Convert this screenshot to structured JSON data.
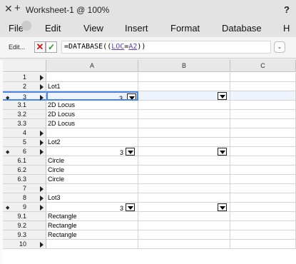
{
  "window": {
    "title": "Worksheet-1 @ 100%",
    "help": "?",
    "close_glyph": "✕",
    "new_glyph": "+"
  },
  "menu": [
    "File",
    "Edit",
    "View",
    "Insert",
    "Format",
    "Database",
    "H"
  ],
  "formula_bar": {
    "edit_label": "Edit...",
    "cancel_glyph": "✕",
    "accept_glyph": "✓",
    "formula_prefix": "=DATABASE((",
    "loc": "LOC",
    "eq": "=",
    "ref": "A2",
    "formula_suffix": "))",
    "dropdown_glyph": "⌄"
  },
  "columns": [
    "A",
    "B",
    "C"
  ],
  "rows": [
    {
      "num": "1",
      "a": "",
      "kind": "normal"
    },
    {
      "num": "2",
      "a": "Lot1",
      "kind": "normal"
    },
    {
      "num": "3",
      "a": "",
      "kind": "db",
      "count": "3",
      "selected": true
    },
    {
      "num": "3.1",
      "a": "2D Locus",
      "kind": "sub"
    },
    {
      "num": "3.2",
      "a": "2D Locus",
      "kind": "sub"
    },
    {
      "num": "3.3",
      "a": "2D Locus",
      "kind": "sub"
    },
    {
      "num": "4",
      "a": "",
      "kind": "normal"
    },
    {
      "num": "5",
      "a": "Lot2",
      "kind": "normal"
    },
    {
      "num": "6",
      "a": "",
      "kind": "db",
      "count": "3"
    },
    {
      "num": "6.1",
      "a": "Circle",
      "kind": "sub"
    },
    {
      "num": "6.2",
      "a": "Circle",
      "kind": "sub"
    },
    {
      "num": "6.3",
      "a": "Circle",
      "kind": "sub"
    },
    {
      "num": "7",
      "a": "",
      "kind": "normal"
    },
    {
      "num": "8",
      "a": "Lot3",
      "kind": "normal"
    },
    {
      "num": "9",
      "a": "",
      "kind": "db",
      "count": "3"
    },
    {
      "num": "9.1",
      "a": "Rectangle",
      "kind": "sub"
    },
    {
      "num": "9.2",
      "a": "Rectangle",
      "kind": "sub"
    },
    {
      "num": "9.3",
      "a": "Rectangle",
      "kind": "sub"
    },
    {
      "num": "10",
      "a": "",
      "kind": "normal"
    }
  ],
  "icons": {
    "diamond": "◆"
  }
}
